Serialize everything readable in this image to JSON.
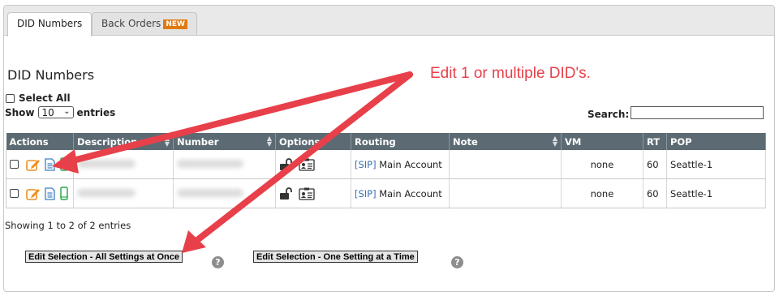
{
  "tabs": [
    {
      "label": "DID Numbers",
      "active": true
    },
    {
      "label": "Back Orders",
      "badge": "NEW",
      "active": false
    }
  ],
  "page_title": "DID Numbers",
  "select_all_label": "Select All",
  "show_label": "Show",
  "page_size": "10",
  "entries_label": "entries",
  "search_label": "Search:",
  "search_value": "",
  "table": {
    "columns": [
      "Actions",
      "Description",
      "Number",
      "Options",
      "Routing",
      "Note",
      "VM",
      "RT",
      "POP"
    ],
    "rows": [
      {
        "description": "",
        "number": "",
        "routing_tag": "[SIP]",
        "routing_target": "Main Account",
        "note": "",
        "vm": "none",
        "rt": "60",
        "pop": "Seattle-1"
      },
      {
        "description": "",
        "number": "",
        "routing_tag": "[SIP]",
        "routing_target": "Main Account",
        "note": "",
        "vm": "none",
        "rt": "60",
        "pop": "Seattle-1"
      }
    ]
  },
  "showing_text": "Showing 1 to 2 of 2 entries",
  "buttons": {
    "edit_all": "Edit Selection - All Settings at Once",
    "edit_one": "Edit Selection - One Setting at a Time",
    "help_glyph": "?"
  },
  "annotation_text": "Edit 1 or multiple DID's.",
  "colors": {
    "header_bg": "#5c6b73",
    "badge": "#e07a10",
    "annotation": "#e8404a",
    "link": "#3b6fb5"
  }
}
